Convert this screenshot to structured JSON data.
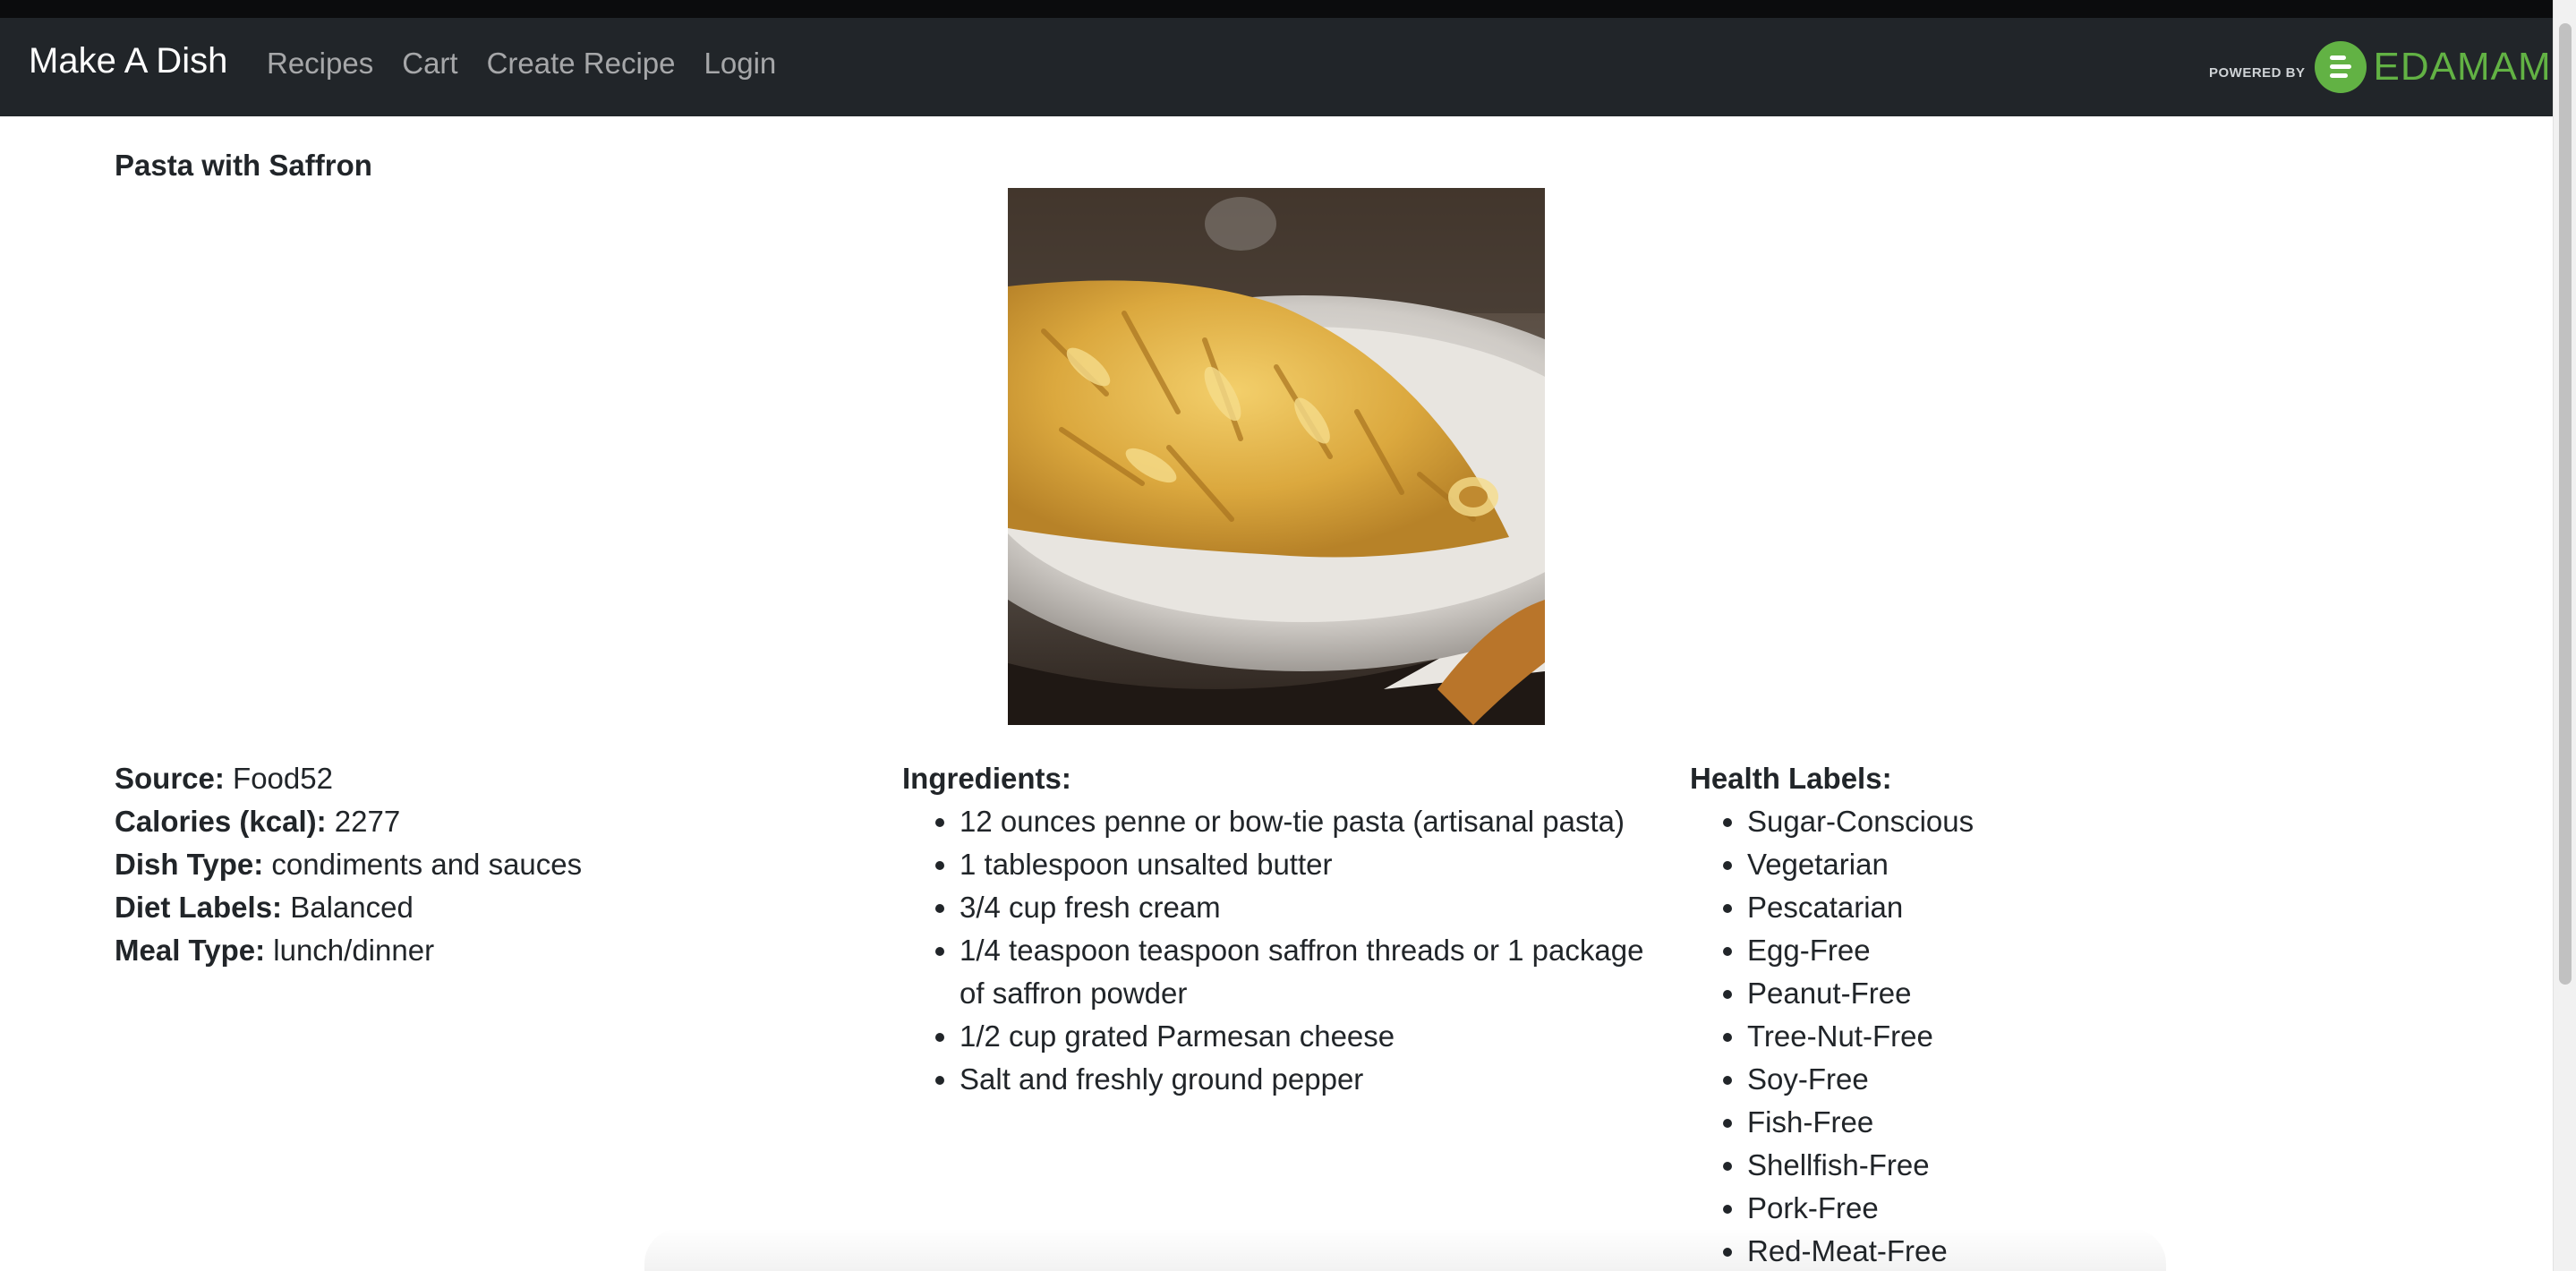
{
  "navbar": {
    "brand": "Make A Dish",
    "links": [
      "Recipes",
      "Cart",
      "Create Recipe",
      "Login"
    ],
    "powered_by": "POWERED BY",
    "edamam_word": "EDAMAM",
    "edamam_color": "#62b244",
    "background": "#212529"
  },
  "recipe": {
    "title": "Pasta with Saffron",
    "image_icon": "pasta-photo",
    "meta": [
      {
        "label": "Source:",
        "value": "Food52"
      },
      {
        "label": "Calories (kcal):",
        "value": "2277"
      },
      {
        "label": "Dish Type:",
        "value": "condiments and sauces"
      },
      {
        "label": "Diet Labels:",
        "value": "Balanced"
      },
      {
        "label": "Meal Type:",
        "value": "lunch/dinner"
      }
    ],
    "ingredients_heading": "Ingredients:",
    "ingredients": [
      "12 ounces penne or bow-tie pasta (artisanal pasta)",
      "1 tablespoon unsalted butter",
      "3/4 cup fresh cream",
      "1/4 teaspoon teaspoon saffron threads or 1 package of saffron powder",
      "1/2 cup grated Parmesan cheese",
      "Salt and freshly ground pepper"
    ],
    "health_heading": "Health Labels:",
    "health_labels": [
      "Sugar-Conscious",
      "Vegetarian",
      "Pescatarian",
      "Egg-Free",
      "Peanut-Free",
      "Tree-Nut-Free",
      "Soy-Free",
      "Fish-Free",
      "Shellfish-Free",
      "Pork-Free",
      "Red-Meat-Free"
    ]
  }
}
